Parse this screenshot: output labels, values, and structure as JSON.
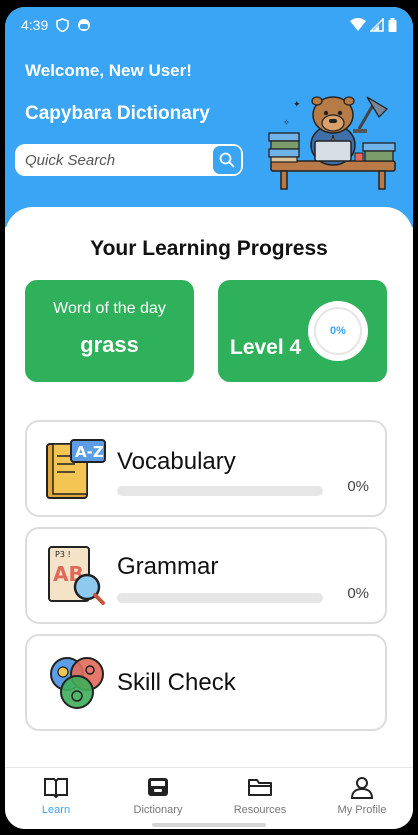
{
  "status_bar": {
    "time": "4:39"
  },
  "header": {
    "welcome": "Welcome, New User!",
    "app_title": "Capybara Dictionary",
    "search_placeholder": "Quick Search"
  },
  "progress": {
    "title": "Your Learning Progress",
    "word_of_day": {
      "label": "Word of the day",
      "word": "grass"
    },
    "level": {
      "label": "Level 4",
      "percent_label": "0%",
      "percent": 0
    }
  },
  "modules": [
    {
      "name": "Vocabulary",
      "percent_label": "0%",
      "progress": 0
    },
    {
      "name": "Grammar",
      "percent_label": "0%",
      "progress": 0
    },
    {
      "name": "Skill Check"
    }
  ],
  "nav": [
    {
      "label": "Learn",
      "icon": "book-icon",
      "active": true
    },
    {
      "label": "Dictionary",
      "icon": "archive-box-icon",
      "active": false
    },
    {
      "label": "Resources",
      "icon": "folder-icon",
      "active": false
    },
    {
      "label": "My Profile",
      "icon": "user-icon",
      "active": false
    }
  ],
  "colors": {
    "primary": "#3aa4f5",
    "green": "#2fb05a"
  }
}
